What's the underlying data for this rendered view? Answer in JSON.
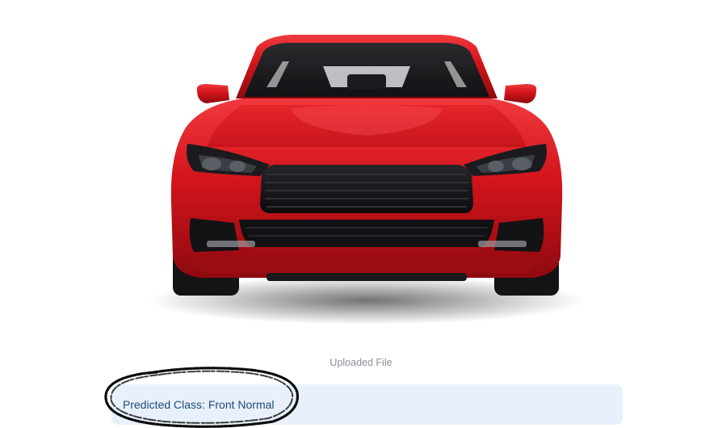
{
  "uploaded_image": {
    "subject": "red car front view",
    "caption": "Uploaded File"
  },
  "prediction": {
    "text": "Predicted Class: Front Normal"
  },
  "colors": {
    "car_body": "#d3141b",
    "result_background": "#e8f1fb",
    "result_text": "#1d4a7a",
    "caption_text": "#8c8f99"
  }
}
